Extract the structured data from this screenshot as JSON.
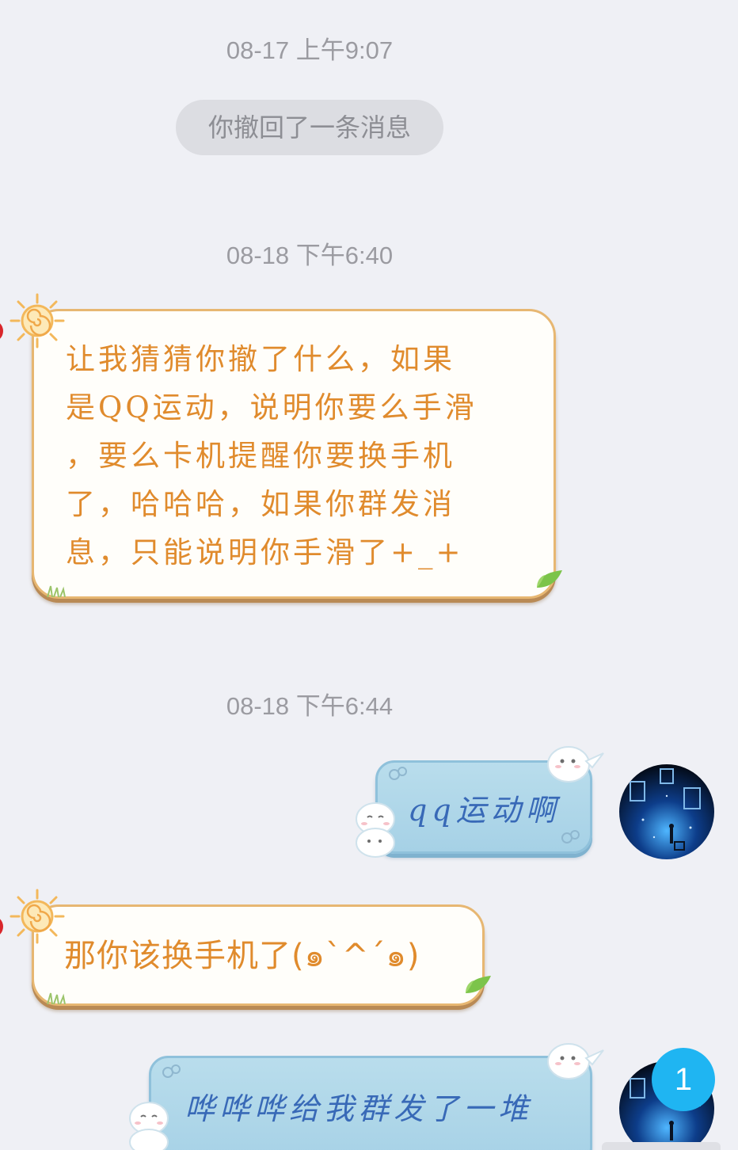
{
  "chat": {
    "timestamps": [
      "08-17 上午9:07",
      "08-18 下午6:40",
      "08-18 下午6:44"
    ],
    "recall_notice": "你撤回了一条消息",
    "messages": [
      {
        "side": "left",
        "lines": [
          "让我猜猜你撤了什么，如果",
          "是QQ运动，说明你要么手滑",
          "，要么卡机提醒你要换手机",
          "了，哈哈哈，如果你群发消",
          "息，只能说明你手滑了+_+"
        ]
      },
      {
        "side": "right",
        "text": "qq运动啊"
      },
      {
        "side": "left",
        "text": "那你该换手机了(๑`^´๑)"
      },
      {
        "side": "right",
        "text": "哗哗哗给我群发了一堆"
      }
    ],
    "unread_count": "1"
  },
  "colors": {
    "background": "#eff0f5",
    "peer_text": "#e08b2d",
    "peer_border": "#e7b772",
    "self_text": "#3869b7",
    "self_bubble": "#a6d1e6",
    "badge": "#1fb5f2"
  },
  "icons": {
    "sun": "sun-icon",
    "leaf": "leaf-icon",
    "snowman": "snowman-icon",
    "avatar": "starry-night-avatar"
  }
}
